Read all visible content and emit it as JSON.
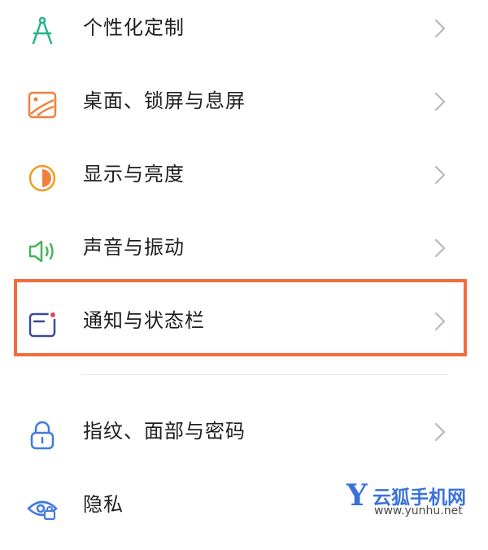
{
  "settings_list": [
    {
      "label": "个性化定制",
      "icon": "compass-icon",
      "color": "#23b38a"
    },
    {
      "label": "桌面、锁屏与息屏",
      "icon": "wallpaper-icon",
      "color": "#f0803c"
    },
    {
      "label": "显示与亮度",
      "icon": "brightness-icon",
      "color": "#f29b1f"
    },
    {
      "label": "声音与振动",
      "icon": "speaker-icon",
      "color": "#47b35b"
    },
    {
      "label": "通知与状态栏",
      "icon": "notification-icon",
      "color": "#3d4a8f"
    },
    {
      "label": "指纹、面部与密码",
      "icon": "lock-icon",
      "color": "#3f7ae0"
    },
    {
      "label": "隐私",
      "icon": "privacy-eye-icon",
      "color": "#3f7ae0"
    }
  ],
  "watermark": {
    "letter": "Y",
    "name": "云狐手机网",
    "url": "www.yunhu.net"
  },
  "colors": {
    "highlight": "#f26d3d",
    "chevron": "#b9b9b9"
  }
}
